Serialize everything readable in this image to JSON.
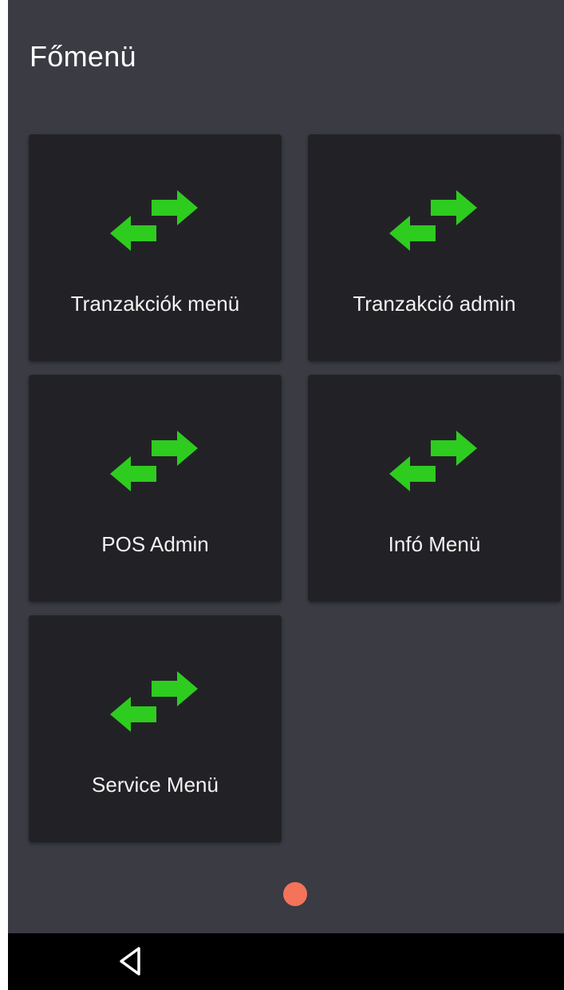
{
  "header": {
    "title": "Főmenü"
  },
  "tiles": [
    {
      "label": "Tranzakciók menü",
      "icon": "transfer-arrows-icon"
    },
    {
      "label": "Tranzakció admin",
      "icon": "transfer-arrows-icon"
    },
    {
      "label": "POS Admin",
      "icon": "transfer-arrows-icon"
    },
    {
      "label": "Infó Menü",
      "icon": "transfer-arrows-icon"
    },
    {
      "label": "Service Menü",
      "icon": "transfer-arrows-icon"
    }
  ],
  "pager": {
    "active_color": "#f4735a"
  },
  "navbar": {
    "back_icon": "back-triangle-icon"
  },
  "colors": {
    "background": "#3a3b43",
    "tile": "#222226",
    "icon_green": "#2ecc1f"
  }
}
